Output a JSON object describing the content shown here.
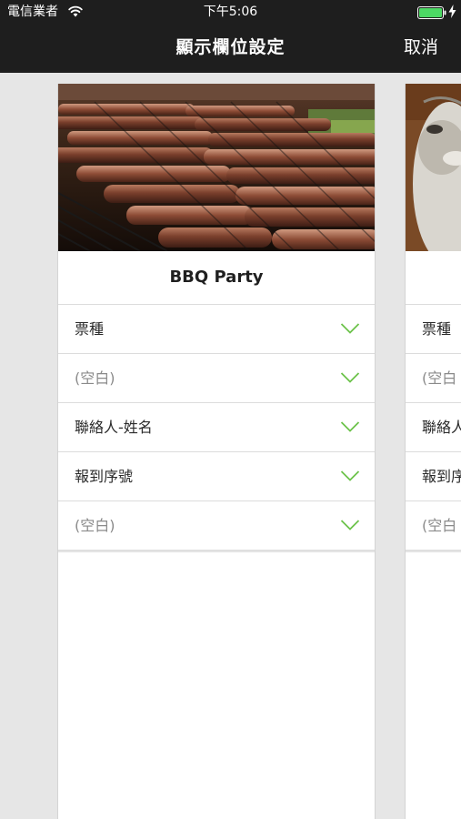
{
  "status_bar": {
    "carrier": "電信業者",
    "time": "下午5:06",
    "icons": [
      "wifi-icon",
      "battery-icon",
      "charging-icon"
    ]
  },
  "nav": {
    "title": "顯示欄位設定",
    "cancel_label": "取消"
  },
  "colors": {
    "nav_background": "#1e1e1e",
    "page_background": "#e6e6e6",
    "chevron": "#6cc24a",
    "battery": "#4cd964"
  },
  "cards": [
    {
      "title": "BBQ Party",
      "fields": [
        {
          "label": "票種",
          "empty": false
        },
        {
          "label": "(空白)",
          "empty": true
        },
        {
          "label": "聯絡人-姓名",
          "empty": false
        },
        {
          "label": "報到序號",
          "empty": false
        },
        {
          "label": "(空白)",
          "empty": true
        }
      ]
    },
    {
      "title": "",
      "fields": [
        {
          "label": "票種",
          "empty": false
        },
        {
          "label": "(空白",
          "empty": true
        },
        {
          "label": "聯絡人",
          "empty": false
        },
        {
          "label": "報到序",
          "empty": false
        },
        {
          "label": "(空白",
          "empty": true
        }
      ]
    }
  ]
}
